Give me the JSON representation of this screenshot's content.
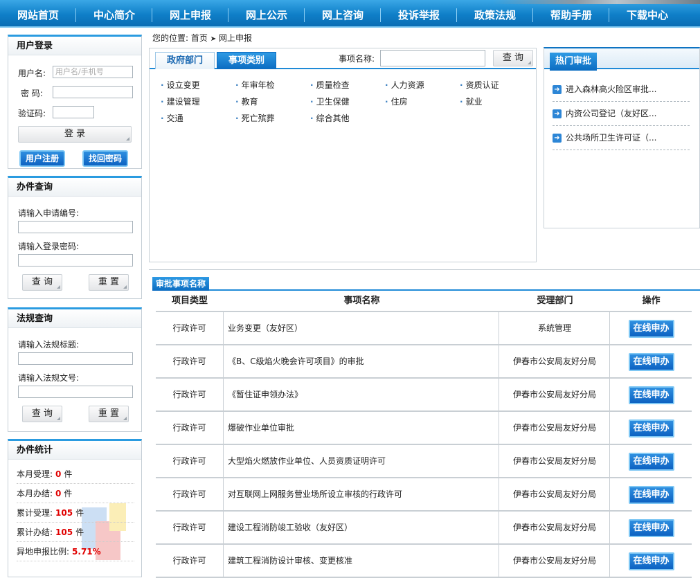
{
  "nav": {
    "items": [
      "网站首页",
      "中心简介",
      "网上申报",
      "网上公示",
      "网上咨询",
      "投诉举报",
      "政策法规",
      "帮助手册",
      "下载中心"
    ]
  },
  "login": {
    "title": "用户登录",
    "username_label": "用户名:",
    "username_placeholder": "用户名/手机号",
    "password_label": "密 码:",
    "captcha_label": "验证码:",
    "login_button": "登 录",
    "register_button": "用户注册",
    "recover_button": "找回密码"
  },
  "case_query": {
    "title": "办件查询",
    "app_no_label": "请输入申请编号:",
    "pwd_label": "请输入登录密码:",
    "query_button": "查 询",
    "reset_button": "重 置"
  },
  "law_query": {
    "title": "法规查询",
    "law_title_label": "请输入法规标题:",
    "law_no_label": "请输入法规文号:",
    "query_button": "查 询",
    "reset_button": "重 置"
  },
  "stats": {
    "title": "办件统计",
    "rows": [
      {
        "label": "本月受理:",
        "value": "0",
        "unit": "件"
      },
      {
        "label": "本月办结:",
        "value": "0",
        "unit": "件"
      },
      {
        "label": "累计受理:",
        "value": "105",
        "unit": "件"
      },
      {
        "label": "累计办结:",
        "value": "105",
        "unit": "件"
      },
      {
        "label": "异地申报比例:",
        "value": "5.71%",
        "unit": ""
      }
    ]
  },
  "breadcrumb": {
    "prefix": "您的位置:",
    "home": "首页",
    "separator": "➤",
    "current": "网上申报"
  },
  "category": {
    "tab_dept": "政府部门",
    "tab_type": "事项类别",
    "search_label": "事项名称:",
    "search_button": "查 询",
    "items": [
      "设立变更",
      "年审年检",
      "质量检查",
      "人力资源",
      "资质认证",
      "建设管理",
      "教育",
      "卫生保健",
      "住房",
      "就业",
      "交通",
      "死亡殡葬",
      "综合其他"
    ]
  },
  "hot": {
    "title": "热门审批",
    "items": [
      "进入森林高火险区审批...",
      "内资公司登记（友好区...",
      "公共场所卫生许可证（..."
    ]
  },
  "list": {
    "title": "审批事项名称",
    "headers": {
      "type": "项目类型",
      "name": "事项名称",
      "dept": "受理部门",
      "op": "操作"
    },
    "apply_label": "在线申办",
    "rows": [
      {
        "type": "行政许可",
        "name": "业务变更（友好区）",
        "dept": "系统管理"
      },
      {
        "type": "行政许可",
        "name": "《B、C级焰火晚会许可项目》的审批",
        "dept": "伊春市公安局友好分局"
      },
      {
        "type": "行政许可",
        "name": "《暂住证申领办法》",
        "dept": "伊春市公安局友好分局"
      },
      {
        "type": "行政许可",
        "name": "爆破作业单位审批",
        "dept": "伊春市公安局友好分局"
      },
      {
        "type": "行政许可",
        "name": "大型焰火燃放作业单位、人员资质证明许可",
        "dept": "伊春市公安局友好分局"
      },
      {
        "type": "行政许可",
        "name": "对互联网上网服务营业场所设立审核的行政许可",
        "dept": "伊春市公安局友好分局"
      },
      {
        "type": "行政许可",
        "name": "建设工程消防竣工验收（友好区）",
        "dept": "伊春市公安局友好分局"
      },
      {
        "type": "行政许可",
        "name": "建筑工程消防设计审核、变更核准",
        "dept": "伊春市公安局友好分局"
      }
    ]
  }
}
